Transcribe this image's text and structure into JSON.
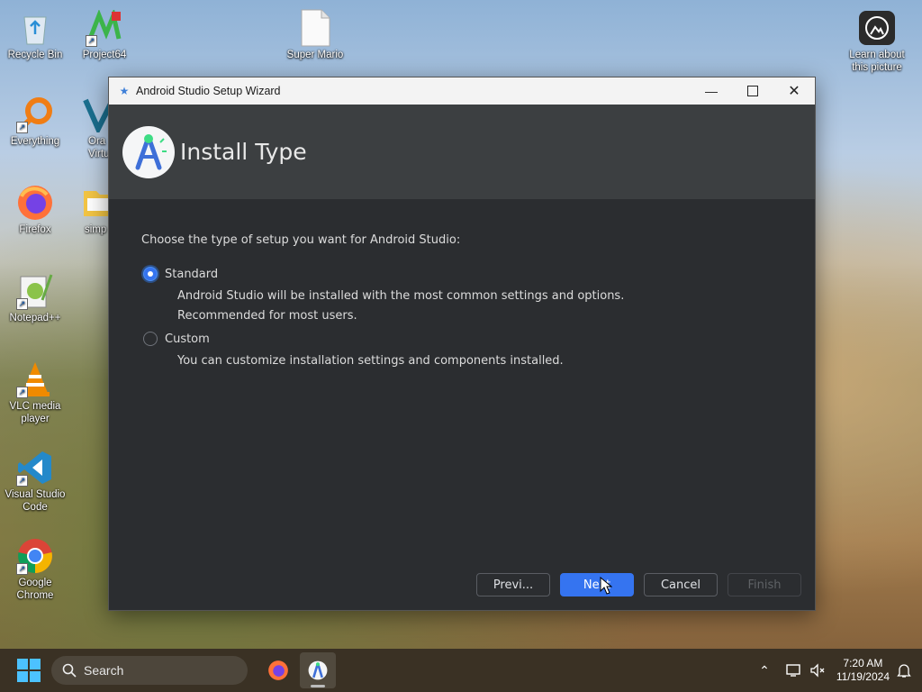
{
  "desktop": {
    "icons": [
      {
        "label": "Recycle Bin",
        "icon": "recycle-bin-icon"
      },
      {
        "label": "Project64",
        "icon": "project64-icon"
      },
      {
        "label": "Super Mario 64 (USA).n64",
        "icon": "file-icon"
      },
      {
        "label": "Learn about this picture",
        "icon": "learn-picture-icon"
      },
      {
        "label": "Everything",
        "icon": "everything-search-icon"
      },
      {
        "label": "Ora Virtua",
        "icon": "virtualbox-icon"
      },
      {
        "label": "Firefox",
        "icon": "firefox-icon"
      },
      {
        "label": "simp",
        "icon": "folder-icon"
      },
      {
        "label": "Notepad++",
        "icon": "notepadpp-icon"
      },
      {
        "label": "VLC media player",
        "icon": "vlc-icon"
      },
      {
        "label": "Visual Studio Code",
        "icon": "vscode-icon"
      },
      {
        "label": "Google Chrome",
        "icon": "chrome-icon"
      }
    ]
  },
  "window": {
    "title": "Android Studio Setup Wizard",
    "header_title": "Install Type",
    "prompt": "Choose the type of setup you want for Android Studio:",
    "options": [
      {
        "label": "Standard",
        "selected": true,
        "desc1": "Android Studio will be installed with the most common settings and options.",
        "desc2": "Recommended for most users."
      },
      {
        "label": "Custom",
        "selected": false,
        "desc1": "You can customize installation settings and components installed."
      }
    ],
    "buttons": {
      "previous": "Previ...",
      "next": "Next",
      "cancel": "Cancel",
      "finish": "Finish"
    }
  },
  "taskbar": {
    "search_placeholder": "Search",
    "time": "7:20 AM",
    "date": "11/19/2024"
  },
  "colors": {
    "accent": "#3574f0",
    "dialog_bg": "#2b2d30",
    "header_bg": "#3c3f41"
  }
}
